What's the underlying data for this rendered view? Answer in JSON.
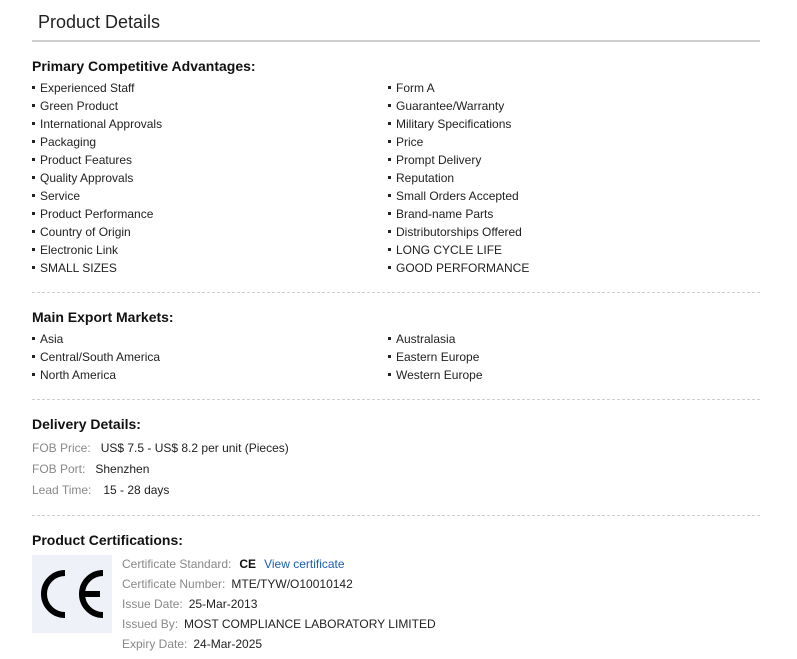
{
  "header": {
    "title": "Product Details"
  },
  "advantages": {
    "heading": "Primary Competitive Advantages:",
    "left": [
      "Experienced Staff",
      "Green Product",
      "International Approvals",
      "Packaging",
      "Product Features",
      "Quality Approvals",
      "Service",
      "Product Performance",
      "Country of Origin",
      "Electronic Link",
      "SMALL SIZES"
    ],
    "right": [
      "Form A",
      "Guarantee/Warranty",
      "Military Specifications",
      "Price",
      "Prompt Delivery",
      "Reputation",
      "Small Orders Accepted",
      "Brand-name Parts",
      "Distributorships Offered",
      "LONG CYCLE LIFE",
      "GOOD PERFORMANCE"
    ]
  },
  "markets": {
    "heading": "Main Export Markets:",
    "left": [
      "Asia",
      "Central/South America",
      "North America"
    ],
    "right": [
      "Australasia",
      "Eastern Europe",
      "Western Europe"
    ]
  },
  "delivery": {
    "heading": "Delivery Details:",
    "fob_price_label": "FOB Price:",
    "fob_price_value": "US$ 7.5 - US$ 8.2 per unit (Pieces)",
    "fob_port_label": "FOB Port:",
    "fob_port_value": "Shenzhen",
    "lead_time_label": "Lead Time:",
    "lead_time_value": "15 - 28 days"
  },
  "certifications": {
    "heading": "Product Certifications:",
    "logo_mark": "CE",
    "standard_label": "Certificate Standard:",
    "standard_value": "CE",
    "view_link": "View certificate",
    "number_label": "Certificate Number:",
    "number_value": "MTE/TYW/O10010142",
    "issue_label": "Issue Date:",
    "issue_value": "25-Mar-2013",
    "issued_by_label": "Issued By:",
    "issued_by_value": "MOST COMPLIANCE LABORATORY LIMITED",
    "expiry_label": "Expiry Date:",
    "expiry_value": "24-Mar-2025"
  },
  "colors": {
    "link": "#1a5fb4",
    "label_gray": "#888888",
    "rule": "#cfcfcf",
    "logo_bg": "#eef1f7"
  }
}
